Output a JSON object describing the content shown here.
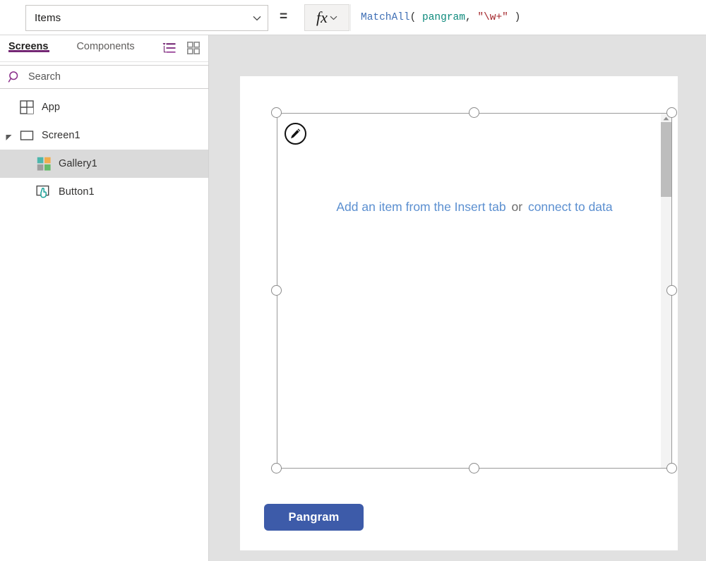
{
  "formula_bar": {
    "property_value": "Items",
    "property_chevron_icon": "chevron-down-icon",
    "equals": "=",
    "fx_label": "fx",
    "fx_chevron_icon": "chevron-down-icon",
    "formula_tokens": [
      {
        "text": "MatchAll",
        "type": "fn"
      },
      {
        "text": "( ",
        "type": "punct"
      },
      {
        "text": "pangram",
        "type": "ident"
      },
      {
        "text": ", ",
        "type": "punct"
      },
      {
        "text": "\"\\w+\"",
        "type": "string"
      },
      {
        "text": " )",
        "type": "punct"
      }
    ],
    "formula_plain": "MatchAll( pangram, \"\\w+\" )"
  },
  "sidebar": {
    "tabs": [
      {
        "label": "Screens",
        "active": true
      },
      {
        "label": "Components",
        "active": false
      }
    ],
    "view_toggles": [
      {
        "icon": "tree-view-icon",
        "active": true
      },
      {
        "icon": "thumbnail-view-icon",
        "active": false
      }
    ],
    "search": {
      "icon": "search-icon",
      "placeholder": "Search",
      "value": ""
    },
    "tree": [
      {
        "label": "App",
        "icon": "app-icon",
        "level": "app",
        "selected": false,
        "expandable": false
      },
      {
        "label": "Screen1",
        "icon": "screen-icon",
        "level": "screen",
        "selected": false,
        "expandable": true,
        "expanded": true
      },
      {
        "label": "Gallery1",
        "icon": "gallery-icon",
        "level": "child",
        "selected": true,
        "expandable": false
      },
      {
        "label": "Button1",
        "icon": "button-icon",
        "level": "child",
        "selected": false,
        "expandable": false
      }
    ]
  },
  "canvas": {
    "gallery": {
      "name": "Gallery1",
      "edit_badge_icon": "pencil-icon",
      "placeholder_link_1": "Add an item from the Insert tab",
      "placeholder_or": "or",
      "placeholder_link_2": "connect to data",
      "scrollbar_up_icon": "caret-up-icon"
    },
    "button": {
      "label": "Pangram"
    }
  },
  "colors": {
    "accent_purple": "#742774",
    "link_blue": "#5b8fd0",
    "button_blue": "#3d5ba9",
    "selection_gray": "#9a9a9a",
    "row_selected": "#dadada",
    "canvas_backdrop": "#e1e1e1",
    "token_fn": "#3f6fb5",
    "token_ident": "#0d8a7c",
    "token_string": "#a3252a"
  }
}
